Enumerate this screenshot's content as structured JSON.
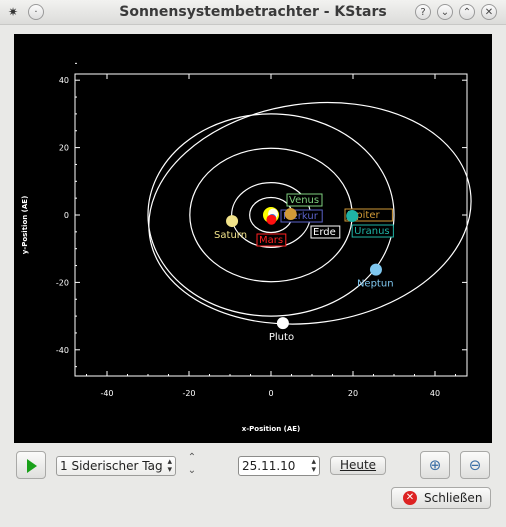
{
  "window": {
    "title": "Sonnensystembetrachter - KStars",
    "help_glyph": "?",
    "minimize_glyph": "⌄",
    "maximize_glyph": "⌃",
    "close_glyph": "✕"
  },
  "chart_data": {
    "type": "scatter",
    "title": "",
    "xlabel": "x-Position (AE)",
    "ylabel": "y-Position (AE)",
    "xlim": [
      -48,
      48
    ],
    "ylim": [
      -48,
      48
    ],
    "xticks": [
      -40,
      -20,
      0,
      20,
      40
    ],
    "yticks": [
      40,
      20,
      0,
      -20,
      -40
    ],
    "tick_labels_x": [
      "-40",
      "-20",
      "0",
      "20",
      "40"
    ],
    "tick_labels_y": [
      "40",
      "20",
      "0",
      "-20",
      "-40"
    ],
    "planets": [
      {
        "name": "Merkur",
        "x": 0.3,
        "y": 0.1,
        "color": "#b8a8a0",
        "label_color": "#5a62c8"
      },
      {
        "name": "Venus",
        "x": 0.5,
        "y": 0.4,
        "color": "#fffff0",
        "label_color": "#7fd07f"
      },
      {
        "name": "Erde",
        "x": 0.3,
        "y": -0.9,
        "color": "#3a7bd5",
        "label_color": "#ffffff"
      },
      {
        "name": "Mars",
        "x": 0.1,
        "y": -1.4,
        "color": "#ff1010",
        "label_color": "#ff2020"
      },
      {
        "name": "Jupiter",
        "x": 4.8,
        "y": 0.3,
        "color": "#d19a37",
        "label_color": "#d19a37"
      },
      {
        "name": "Saturn",
        "x": -9.5,
        "y": -1.8,
        "color": "#f2e38a",
        "label_color": "#f2e38a"
      },
      {
        "name": "Uranus",
        "x": 19.8,
        "y": -0.3,
        "color": "#1fb3a5",
        "label_color": "#1fb3a5"
      },
      {
        "name": "Neptun",
        "x": 25.6,
        "y": -16.2,
        "color": "#7fc7ef",
        "label_color": "#7fc7ef"
      },
      {
        "name": "Pluto",
        "x": 2.9,
        "y": -32.1,
        "color": "#ffffff",
        "label_color": "#ffffff"
      }
    ],
    "sun": {
      "x": 0,
      "y": 0,
      "color": "#ffff00"
    },
    "grid": false
  },
  "controls": {
    "timestep_value": "1 Siderischer Tag",
    "date_value": "25.11.10",
    "today_label": "Heute",
    "close_label": "Schließen",
    "zoom_in_glyph": "⊕",
    "zoom_out_glyph": "⊖",
    "step_up_glyph": "⌃",
    "step_down_glyph": "⌄",
    "dropdown_glyph": "▴▾"
  }
}
